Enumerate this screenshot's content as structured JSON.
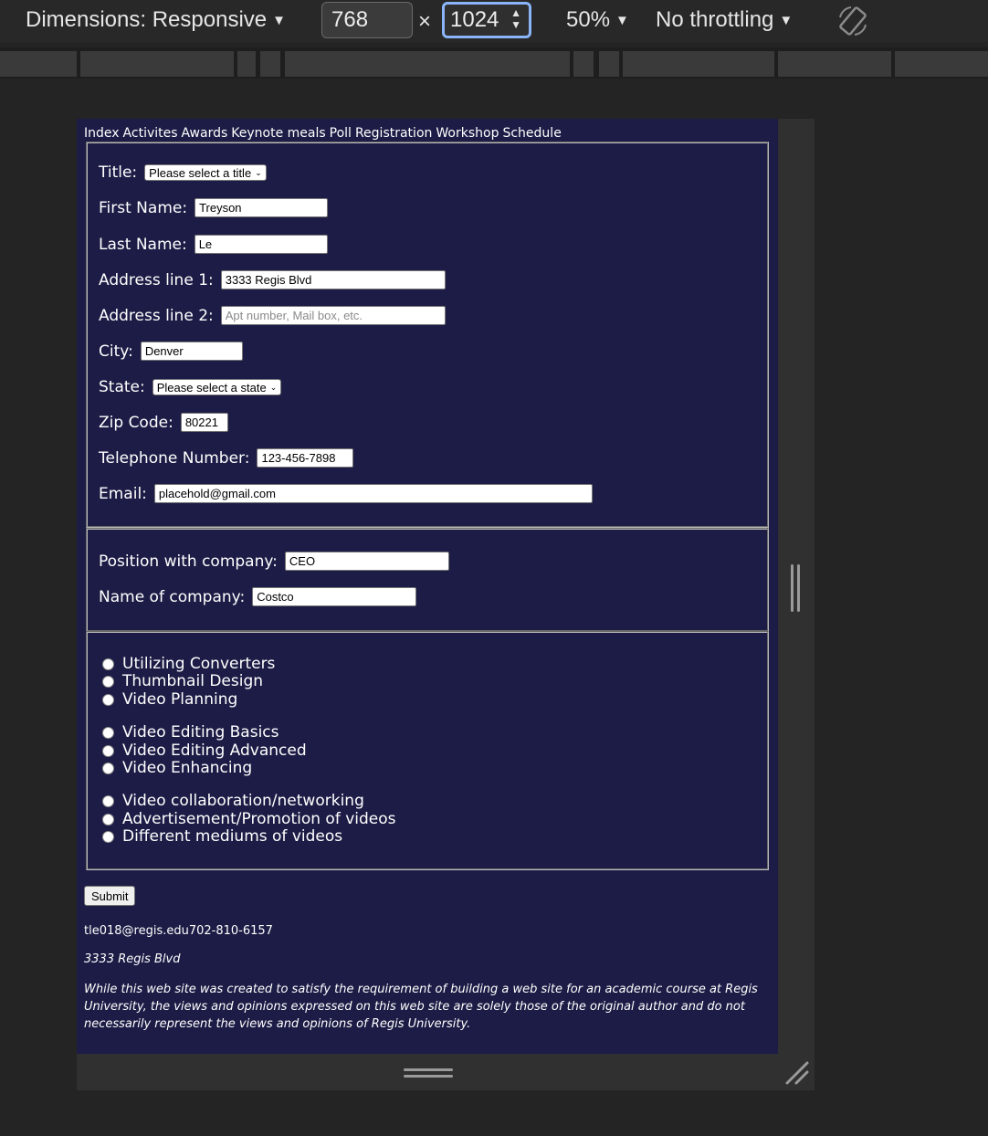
{
  "devtools": {
    "dimensions_label": "Dimensions: Responsive",
    "width_value": "768",
    "times": "×",
    "height_value": "1024",
    "zoom": "50%",
    "throttling": "No throttling",
    "icons": [
      "caret-down-icon",
      "spinner-icon",
      "rotate-icon",
      "resize-handle-icon"
    ]
  },
  "nav": {
    "items": [
      "Index",
      "Activites",
      "Awards",
      "Keynote meals",
      "Poll",
      "Registration",
      "Workshop",
      "Schedule"
    ]
  },
  "personal": {
    "title_label": "Title:",
    "title_select": "Please select a title",
    "first_label": "First Name:",
    "first_value": "Treyson",
    "last_label": "Last Name:",
    "last_value": "Le",
    "addr1_label": "Address line 1:",
    "addr1_value": "3333 Regis Blvd",
    "addr2_label": "Address line 2:",
    "addr2_placeholder": "Apt number, Mail box, etc.",
    "city_label": "City:",
    "city_value": "Denver",
    "state_label": "State:",
    "state_select": "Please select a state",
    "zip_label": "Zip Code:",
    "zip_value": "80221",
    "phone_label": "Telephone Number:",
    "phone_value": "123-456-7898",
    "email_label": "Email:",
    "email_value": "placehold@gmail.com"
  },
  "company": {
    "position_label": "Position with company:",
    "position_value": "CEO",
    "name_label": "Name of company:",
    "name_value": "Costco"
  },
  "workshops": {
    "group1": [
      "Utilizing Converters",
      "Thumbnail Design",
      "Video Planning"
    ],
    "group2": [
      "Video Editing Basics",
      "Video Editing Advanced",
      "Video Enhancing"
    ],
    "group3": [
      "Video collaboration/networking",
      "Advertisement/Promotion of videos",
      "Different mediums of videos"
    ]
  },
  "submit_label": "Submit",
  "footer": {
    "contact": "tle018@regis.edu702-810-6157",
    "address": "3333 Regis Blvd",
    "disclaimer": "While this web site was created to satisfy the requirement of building a web site for an academic course at Regis University, the views and opinions expressed on this web site are solely those of the original author and do not necessarily represent the views and opinions of Regis University."
  },
  "colors": {
    "page_bg": "#1c1c46",
    "toolbar_bg": "#282828",
    "focus_ring": "#8ab4f8"
  }
}
